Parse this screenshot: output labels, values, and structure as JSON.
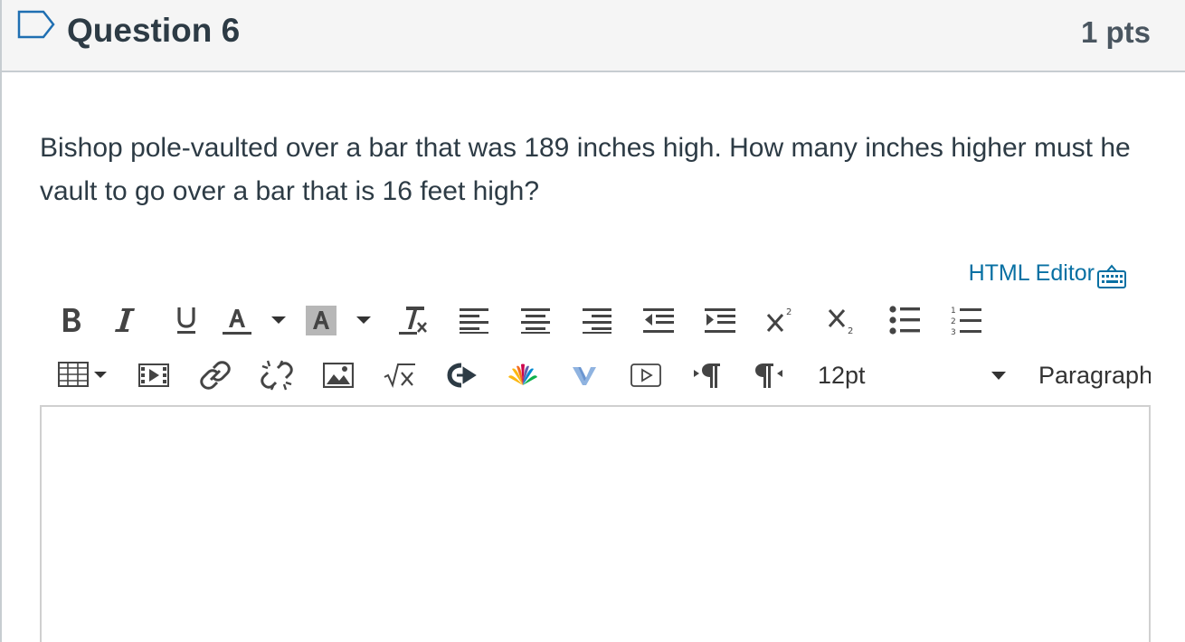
{
  "question": {
    "title": "Question 6",
    "points": "1 pts",
    "text": "Bishop pole-vaulted over a bar that was 189 inches high.  How many inches higher must he vault to go over a bar that is 16 feet high?"
  },
  "editor": {
    "html_editor_label": "HTML Editor",
    "font_size": "12pt",
    "format": "Paragraph",
    "content": "",
    "toolbar_row1": [
      "bold-icon",
      "italic-icon",
      "underline-icon",
      "text-color-icon",
      "text-color-dropdown-icon",
      "background-color-icon",
      "background-color-dropdown-icon",
      "clear-formatting-icon",
      "align-left-icon",
      "align-center-icon",
      "align-right-icon",
      "outdent-icon",
      "indent-icon",
      "superscript-icon",
      "subscript-icon",
      "bulleted-list-icon",
      "numbered-list-icon"
    ],
    "toolbar_row2": [
      "table-icon",
      "media-icon",
      "link-icon",
      "unlink-icon",
      "image-icon",
      "math-equation-icon",
      "external-tool-icon",
      "nbc-learn-icon",
      "vimeo-icon",
      "embed-video-icon",
      "ltr-paragraph-icon",
      "rtl-paragraph-icon"
    ]
  },
  "colors": {
    "header_bg": "#f5f5f5",
    "link": "#0770a3",
    "text": "#2d3b45",
    "border": "#c7cdd1"
  }
}
